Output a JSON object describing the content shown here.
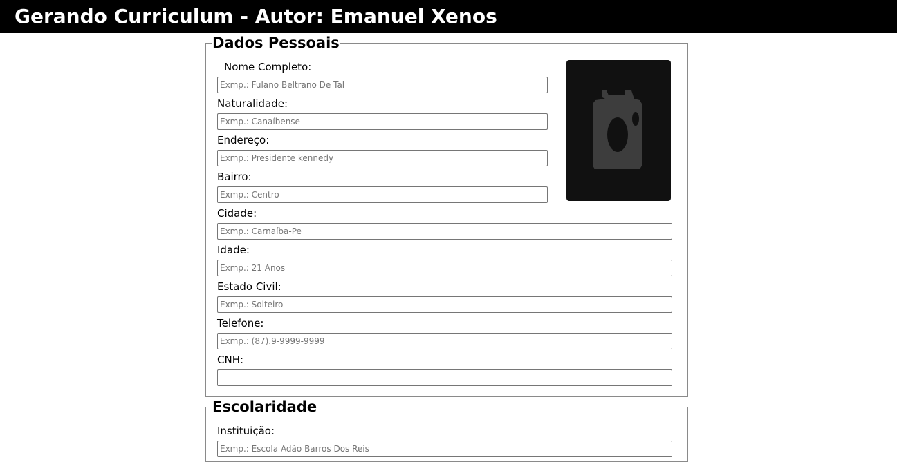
{
  "header": {
    "title": "Gerando Curriculum - Autor: Emanuel Xenos"
  },
  "dados_pessoais": {
    "legend": "Dados Pessoais",
    "photo_icon": "camera-icon",
    "fields": [
      {
        "label": "Nome Completo:",
        "placeholder": "Exmp.: Fulano Beltrano De Tal",
        "value": ""
      },
      {
        "label": "Naturalidade:",
        "placeholder": "Exmp.: Canaíbense",
        "value": ""
      },
      {
        "label": "Endereço:",
        "placeholder": "Exmp.: Presidente kennedy",
        "value": ""
      },
      {
        "label": "Bairro:",
        "placeholder": "Exmp.: Centro",
        "value": ""
      },
      {
        "label": "Cidade:",
        "placeholder": "Exmp.: Carnaíba-Pe",
        "value": ""
      },
      {
        "label": "Idade:",
        "placeholder": "Exmp.: 21 Anos",
        "value": ""
      },
      {
        "label": "Estado Civil:",
        "placeholder": "Exmp.: Solteiro",
        "value": ""
      },
      {
        "label": "Telefone:",
        "placeholder": "Exmp.: (87).9-9999-9999",
        "value": ""
      },
      {
        "label": "CNH:",
        "placeholder": "",
        "value": ""
      }
    ]
  },
  "escolaridade": {
    "legend": "Escolaridade",
    "fields": [
      {
        "label": "Instituição:",
        "placeholder": "Exmp.: Escola Adão Barros Dos Reis",
        "value": ""
      }
    ]
  }
}
